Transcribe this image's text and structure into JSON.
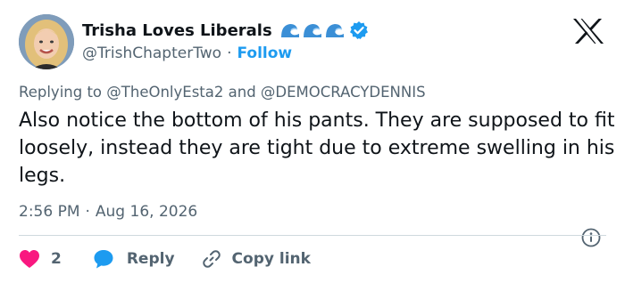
{
  "author": {
    "display_name": "Trisha Loves Liberals",
    "handle": "@TrishChapterTwo",
    "separator": "·",
    "follow_label": "Follow",
    "emoji_icons": [
      "wave-icon",
      "wave-icon",
      "wave-icon"
    ],
    "verified": true
  },
  "reply_context": {
    "prefix": "Replying to",
    "mention_1": "@TheOnlyEsta2",
    "conjunction": "and",
    "mention_2": "@DEMOCRACYDENNIS"
  },
  "tweet": {
    "text": "Also notice the bottom of his pants. They are supposed to fit loosely, instead they are tight due to extreme swelling in his legs."
  },
  "meta": {
    "time": "2:56 PM",
    "dot": "·",
    "date": "Aug 16, 2026"
  },
  "actions": {
    "like_count": "2",
    "reply_label": "Reply",
    "copy_link_label": "Copy link"
  },
  "colors": {
    "brand_blue": "#1d9bf0",
    "like_red": "#f91880",
    "secondary_text": "#536471",
    "wave": "#3b8fd6"
  }
}
